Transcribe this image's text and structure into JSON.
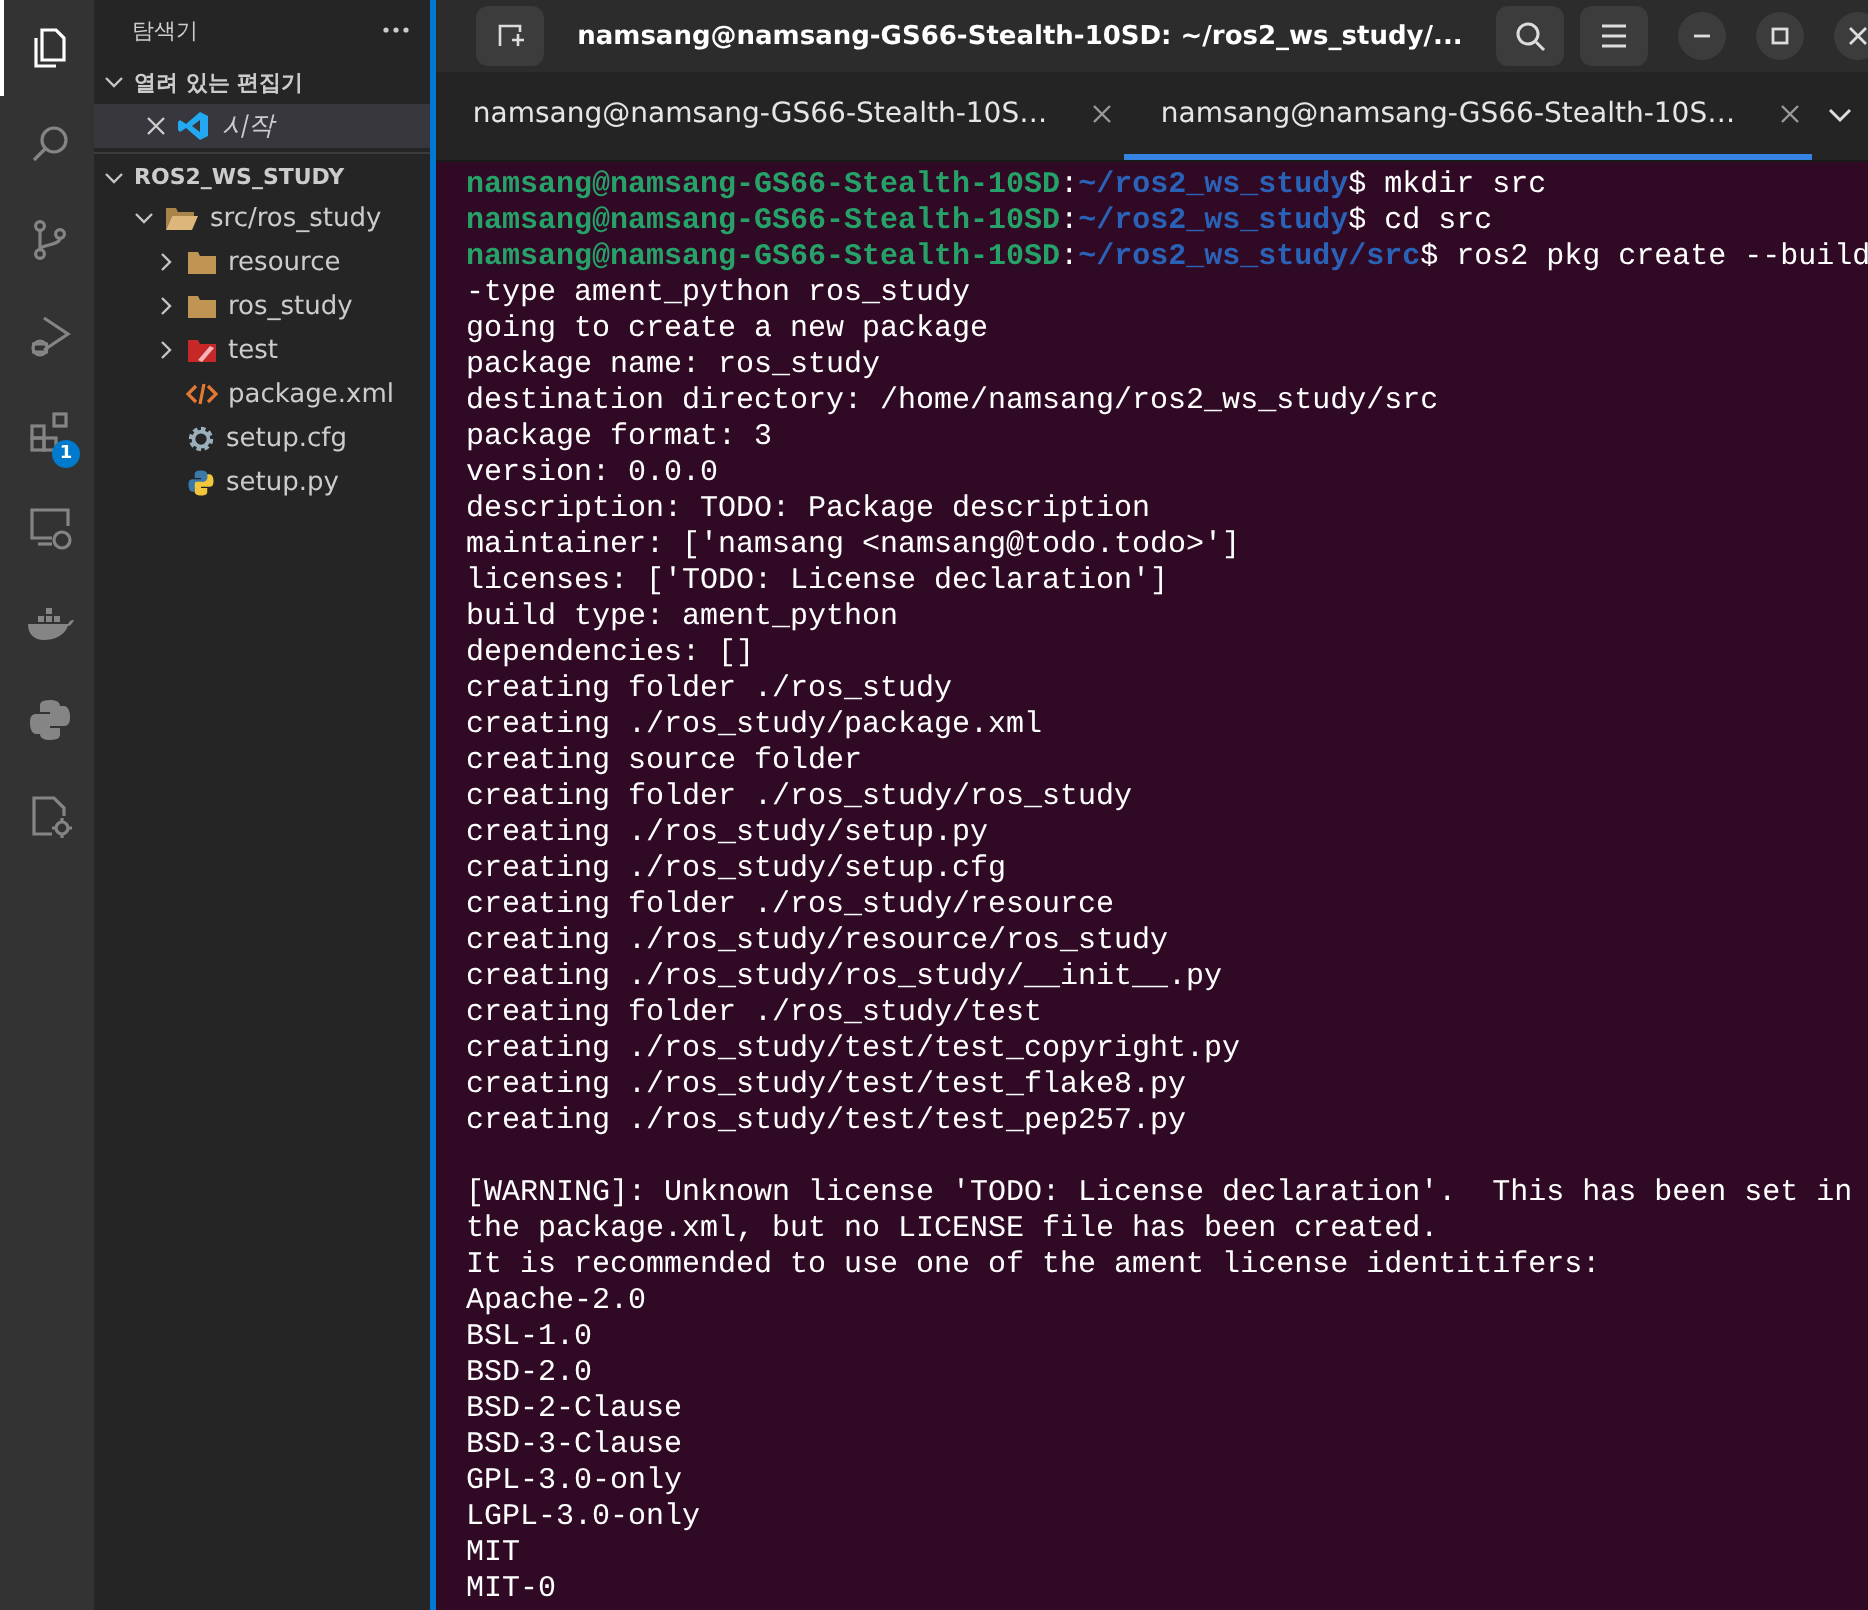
{
  "activity_bar": [
    {
      "kind": "files",
      "selected": true
    },
    {
      "kind": "search",
      "selected": false
    },
    {
      "kind": "source-control",
      "selected": false
    },
    {
      "kind": "run-debug",
      "selected": false
    },
    {
      "kind": "extensions",
      "selected": false,
      "badge": "1"
    },
    {
      "kind": "remote",
      "selected": false
    },
    {
      "kind": "docker",
      "selected": false
    },
    {
      "kind": "python",
      "selected": false
    },
    {
      "kind": "cpp",
      "selected": false
    }
  ],
  "sidebar": {
    "title": "탐색기",
    "open_editors": {
      "title": "열려 있는 편집기",
      "expanded": true,
      "items": [
        {
          "label": "시작",
          "selected": true
        }
      ]
    },
    "workspace": {
      "title": "ROS2_WS_STUDY",
      "expanded": true,
      "tree": [
        {
          "label": "src/ros_study",
          "kind": "folder",
          "expanded": true,
          "children": [
            {
              "label": "resource",
              "kind": "folder",
              "expanded": false
            },
            {
              "label": "ros_study",
              "kind": "folder",
              "expanded": false
            },
            {
              "label": "test",
              "kind": "test-folder",
              "expanded": false
            },
            {
              "label": "package.xml",
              "kind": "xml"
            },
            {
              "label": "setup.cfg",
              "kind": "config"
            },
            {
              "label": "setup.py",
              "kind": "python"
            }
          ]
        }
      ]
    }
  },
  "terminal": {
    "title": "namsang@namsang-GS66-Stealth-10SD: ~/ros2_ws_study/...",
    "tabs": [
      {
        "label": "namsang@namsang-GS66-Stealth-10S…",
        "selected": false
      },
      {
        "label": "namsang@namsang-GS66-Stealth-10S…",
        "selected": true
      }
    ],
    "lines": [
      {
        "kind": "prompt",
        "user": "namsang@namsang-GS66-Stealth-10SD",
        "sep": ":",
        "path": "~/ros2_ws_study",
        "command": "$ mkdir src"
      },
      {
        "kind": "prompt",
        "user": "namsang@namsang-GS66-Stealth-10SD",
        "sep": ":",
        "path": "~/ros2_ws_study",
        "command": "$ cd src"
      },
      {
        "kind": "prompt",
        "user": "namsang@namsang-GS66-Stealth-10SD",
        "sep": ":",
        "path": "~/ros2_ws_study/src",
        "command": "$ ros2 pkg create --build"
      },
      {
        "kind": "text",
        "text": "-type ament_python ros_study"
      },
      {
        "kind": "text",
        "text": "going to create a new package"
      },
      {
        "kind": "text",
        "text": "package name: ros_study"
      },
      {
        "kind": "text",
        "text": "destination directory: /home/namsang/ros2_ws_study/src"
      },
      {
        "kind": "text",
        "text": "package format: 3"
      },
      {
        "kind": "text",
        "text": "version: 0.0.0"
      },
      {
        "kind": "text",
        "text": "description: TODO: Package description"
      },
      {
        "kind": "text",
        "text": "maintainer: ['namsang <namsang@todo.todo>']"
      },
      {
        "kind": "text",
        "text": "licenses: ['TODO: License declaration']"
      },
      {
        "kind": "text",
        "text": "build type: ament_python"
      },
      {
        "kind": "text",
        "text": "dependencies: []"
      },
      {
        "kind": "text",
        "text": "creating folder ./ros_study"
      },
      {
        "kind": "text",
        "text": "creating ./ros_study/package.xml"
      },
      {
        "kind": "text",
        "text": "creating source folder"
      },
      {
        "kind": "text",
        "text": "creating folder ./ros_study/ros_study"
      },
      {
        "kind": "text",
        "text": "creating ./ros_study/setup.py"
      },
      {
        "kind": "text",
        "text": "creating ./ros_study/setup.cfg"
      },
      {
        "kind": "text",
        "text": "creating folder ./ros_study/resource"
      },
      {
        "kind": "text",
        "text": "creating ./ros_study/resource/ros_study"
      },
      {
        "kind": "text",
        "text": "creating ./ros_study/ros_study/__init__.py"
      },
      {
        "kind": "text",
        "text": "creating folder ./ros_study/test"
      },
      {
        "kind": "text",
        "text": "creating ./ros_study/test/test_copyright.py"
      },
      {
        "kind": "text",
        "text": "creating ./ros_study/test/test_flake8.py"
      },
      {
        "kind": "text",
        "text": "creating ./ros_study/test/test_pep257.py"
      },
      {
        "kind": "blank"
      },
      {
        "kind": "text",
        "text": "[WARNING]: Unknown license 'TODO: License declaration'.  This has been set in"
      },
      {
        "kind": "text",
        "text": "the package.xml, but no LICENSE file has been created."
      },
      {
        "kind": "text",
        "text": "It is recommended to use one of the ament license identitifers:"
      },
      {
        "kind": "text",
        "text": "Apache-2.0"
      },
      {
        "kind": "text",
        "text": "BSL-1.0"
      },
      {
        "kind": "text",
        "text": "BSD-2.0"
      },
      {
        "kind": "text",
        "text": "BSD-2-Clause"
      },
      {
        "kind": "text",
        "text": "BSD-3-Clause"
      },
      {
        "kind": "text",
        "text": "GPL-3.0-only"
      },
      {
        "kind": "text",
        "text": "LGPL-3.0-only"
      },
      {
        "kind": "text",
        "text": "MIT"
      },
      {
        "kind": "text",
        "text": "MIT-0"
      }
    ]
  }
}
